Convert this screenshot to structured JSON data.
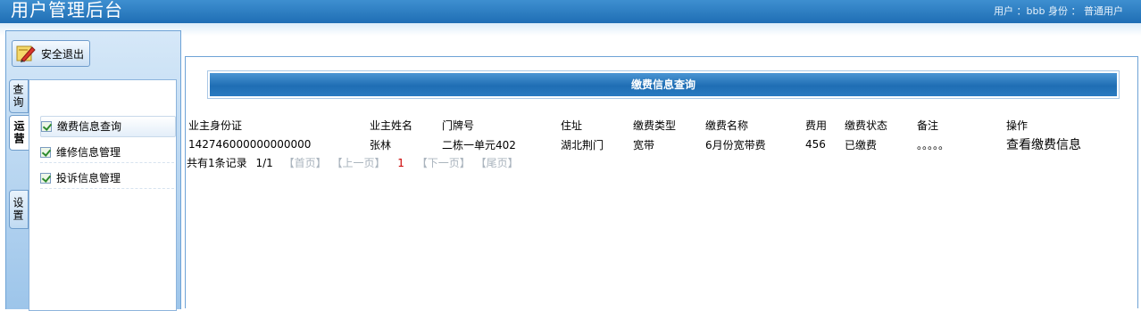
{
  "header": {
    "title": "用户管理后台",
    "user_info": "用户 ：bbb  身份 ： 普通用户"
  },
  "sidebar": {
    "logout_label": "安全退出",
    "tabs": [
      {
        "label": "查询"
      },
      {
        "label": "运营"
      },
      {
        "label": "设置"
      }
    ],
    "items": [
      {
        "label": "缴费信息查询"
      },
      {
        "label": "维修信息管理"
      },
      {
        "label": "投诉信息管理"
      }
    ]
  },
  "main": {
    "section_title": "缴费信息查询",
    "table": {
      "headers": [
        "业主身份证",
        "业主姓名",
        "门牌号",
        "住址",
        "缴费类型",
        "缴费名称",
        "费用",
        "缴费状态",
        "备注",
        "操作"
      ],
      "rows": [
        [
          "142746000000000000",
          "张林",
          "二栋一单元402",
          "湖北荆门",
          "宽带",
          "6月份宽带费",
          "456",
          "已缴费",
          "。。。。。",
          "查看缴费信息"
        ]
      ]
    },
    "pager": {
      "summary": "共有1条记录",
      "page": "1/1",
      "first": "【首页】",
      "prev": "【上一页】",
      "current": "1",
      "next": "【下一页】",
      "last": "【尾页】"
    }
  },
  "colors": {
    "header_blue": "#1f6eb4",
    "panel_border": "#6ea3d6",
    "current_page": "#cc0000"
  }
}
